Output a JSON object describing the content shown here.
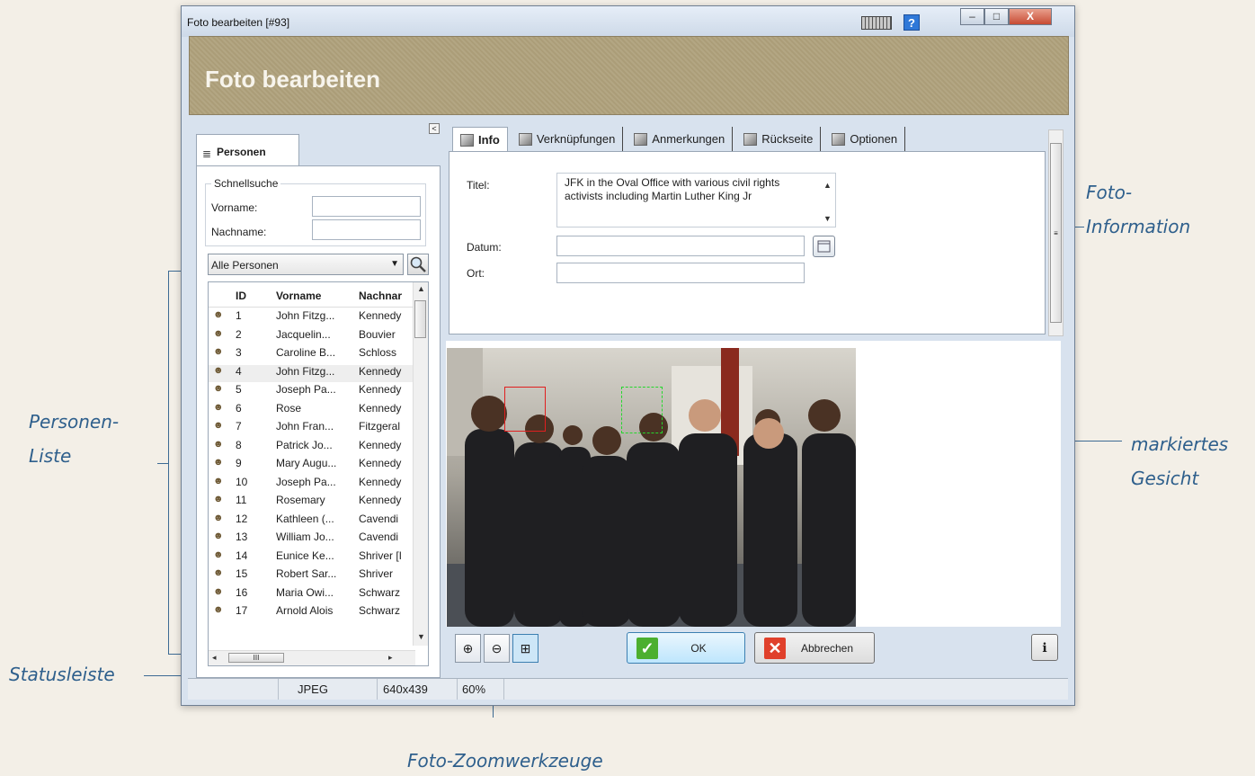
{
  "window": {
    "title": "Foto bearbeiten [#93]",
    "header_title": "Foto bearbeiten",
    "minimize": "–",
    "maximize": "□",
    "close": "X",
    "help": "?"
  },
  "annotations": {
    "personen_liste_1": "Personen-",
    "personen_liste_2": "Liste",
    "statusleiste": "Statusleiste",
    "foto_info_1": "Foto-",
    "foto_info_2": "Information",
    "markiertes_1": "markiertes",
    "markiertes_2": "Gesicht",
    "zoom": "Foto-Zoomwerkzeuge"
  },
  "left": {
    "collapse": "<",
    "tab_label": "Personen",
    "quicksearch_title": "Schnellsuche",
    "vorname_label": "Vorname:",
    "nachname_label": "Nachname:",
    "vorname_value": "",
    "nachname_value": "",
    "filter_selected": "Alle Personen",
    "columns": {
      "id": "ID",
      "vorname": "Vorname",
      "nachname": "Nachnar"
    },
    "scroll_thumb": "III",
    "rows": [
      {
        "id": "1",
        "vorname": "John Fitzg...",
        "nachname": "Kennedy"
      },
      {
        "id": "2",
        "vorname": "Jacquelin...",
        "nachname": "Bouvier"
      },
      {
        "id": "3",
        "vorname": "Caroline B...",
        "nachname": "Schloss"
      },
      {
        "id": "4",
        "vorname": "John Fitzg...",
        "nachname": "Kennedy"
      },
      {
        "id": "5",
        "vorname": "Joseph Pa...",
        "nachname": "Kennedy"
      },
      {
        "id": "6",
        "vorname": "Rose",
        "nachname": "Kennedy"
      },
      {
        "id": "7",
        "vorname": "John Fran...",
        "nachname": "Fitzgeral"
      },
      {
        "id": "8",
        "vorname": "Patrick Jo...",
        "nachname": "Kennedy"
      },
      {
        "id": "9",
        "vorname": "Mary Augu...",
        "nachname": "Kennedy"
      },
      {
        "id": "10",
        "vorname": "Joseph Pa...",
        "nachname": "Kennedy"
      },
      {
        "id": "11",
        "vorname": "Rosemary",
        "nachname": "Kennedy"
      },
      {
        "id": "12",
        "vorname": "Kathleen (...",
        "nachname": "Cavendi"
      },
      {
        "id": "13",
        "vorname": "William Jo...",
        "nachname": "Cavendi"
      },
      {
        "id": "14",
        "vorname": "Eunice Ke...",
        "nachname": "Shriver [I"
      },
      {
        "id": "15",
        "vorname": "Robert Sar...",
        "nachname": "Shriver"
      },
      {
        "id": "16",
        "vorname": "Maria Owi...",
        "nachname": "Schwarz"
      },
      {
        "id": "17",
        "vorname": "Arnold Alois",
        "nachname": "Schwarz"
      }
    ]
  },
  "tabs": [
    "Info",
    "Verknüpfungen",
    "Anmerkungen",
    "Rückseite",
    "Optionen"
  ],
  "info": {
    "titel_label": "Titel:",
    "titel_value": "JFK in the Oval Office with various civil rights activists including Martin Luther King Jr",
    "datum_label": "Datum:",
    "datum_value": "",
    "ort_label": "Ort:",
    "ort_value": ""
  },
  "buttons": {
    "zoom_in": "⊕",
    "zoom_out": "⊖",
    "zoom_fit": "⊞",
    "ok": "OK",
    "ok_icon": "✓",
    "cancel": "Abbrechen",
    "cancel_icon": "✕",
    "info": "ℹ"
  },
  "status": {
    "format": "JPEG",
    "dimensions": "640x439",
    "zoom": "60%"
  }
}
